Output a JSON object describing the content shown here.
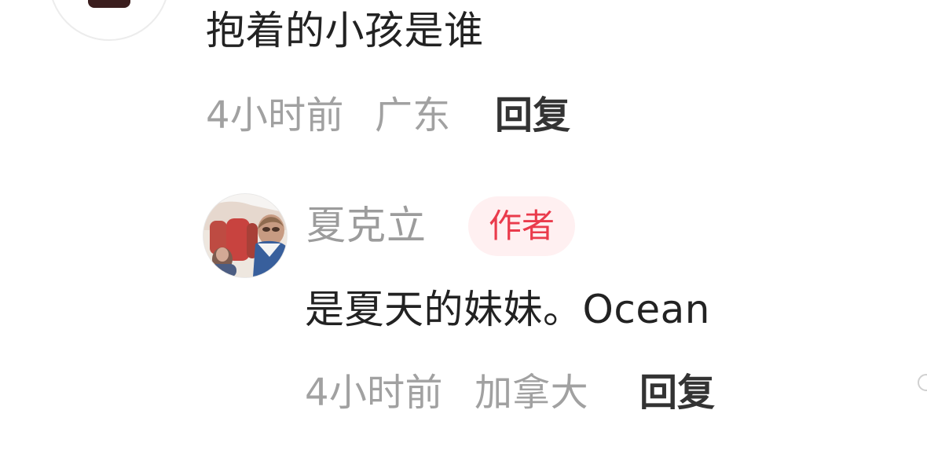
{
  "main_comment": {
    "text": "抱着的小孩是谁",
    "time": "4小时前",
    "location": "广东",
    "reply_label": "回复"
  },
  "reply_comment": {
    "username": "夏克立",
    "badge": "作者",
    "text": "是夏天的妹妹。Ocean",
    "time": "4小时前",
    "location": "加拿大",
    "reply_label": "回复"
  },
  "colors": {
    "text_primary": "#222222",
    "text_secondary": "#a1a1a1",
    "badge_text": "#ea3b4c",
    "badge_background": "#fff0f1",
    "reply_button": "#333333"
  },
  "icons": {
    "top_avatar": "user-avatar-icon",
    "reply_avatar": "user-avatar-icon",
    "right_edge": "partial-circle-icon"
  }
}
